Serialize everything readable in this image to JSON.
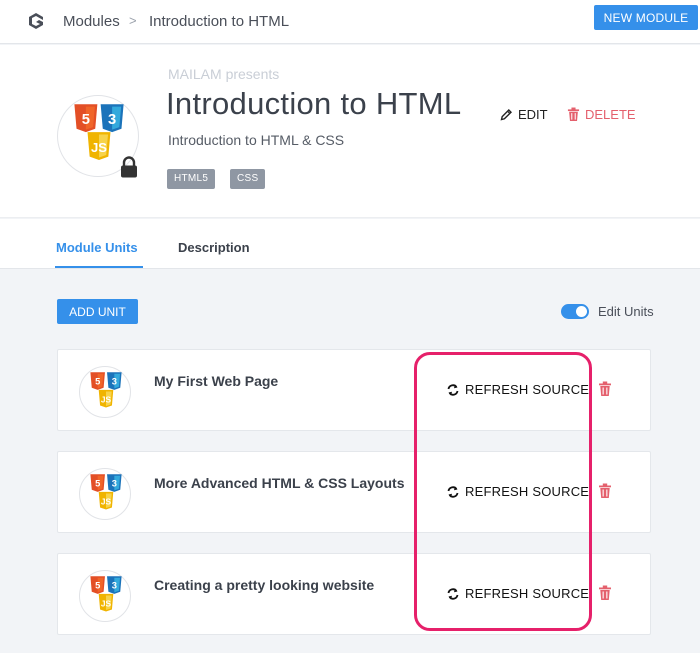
{
  "topbar": {
    "breadcrumb": [
      "Modules",
      "Introduction to HTML"
    ],
    "breadcrumb_separator": ">",
    "new_module_label": "NEW MODULE"
  },
  "module": {
    "presenter": "MAILAM presents",
    "title": "Introduction to HTML",
    "subtitle": "Introduction to HTML & CSS",
    "edit_label": "EDIT",
    "delete_label": "DELETE",
    "tags": [
      "HTML5",
      "CSS"
    ],
    "locked": true
  },
  "tabs": [
    {
      "label": "Module Units",
      "active": true
    },
    {
      "label": "Description",
      "active": false
    }
  ],
  "toolbar": {
    "add_unit_label": "ADD UNIT",
    "edit_units_label": "Edit Units",
    "edit_units_on": true
  },
  "units": [
    {
      "name": "My First Web Page",
      "refresh_label": "REFRESH SOURCE"
    },
    {
      "name": "More Advanced HTML & CSS Layouts",
      "refresh_label": "REFRESH SOURCE"
    },
    {
      "name": "Creating a pretty looking website",
      "refresh_label": "REFRESH SOURCE"
    }
  ],
  "colors": {
    "accent": "#3590ea",
    "danger": "#e4606d",
    "highlight": "#e6206a",
    "html5": "#e34f26",
    "css3": "#1b73ba",
    "js": "#f0b400"
  },
  "icons": {
    "logo": "app-logo-icon",
    "edit": "pencil-icon",
    "delete": "trash-icon",
    "lock": "lock-icon",
    "refresh": "refresh-icon"
  }
}
